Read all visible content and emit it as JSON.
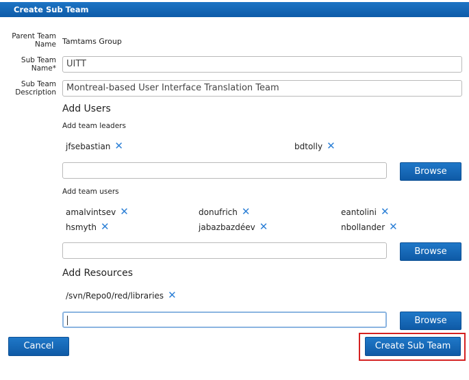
{
  "dialog": {
    "title": "Create Sub Team"
  },
  "form": {
    "parent_team_label": "Parent Team Name",
    "parent_team_value": "Tamtams Group",
    "sub_team_name_label": "Sub Team Name*",
    "sub_team_name_value": "UITT",
    "sub_team_description_label": "Sub Team Description",
    "sub_team_description_value": "Montreal-based User Interface Translation Team"
  },
  "add_users": {
    "heading": "Add Users",
    "leaders_label": "Add team leaders",
    "leaders": [
      "jfsebastian",
      "bdtolly"
    ],
    "users_label": "Add team users",
    "users": [
      "amalvintsev",
      "donufrich",
      "eantolini",
      "hsmyth",
      "jabazbazdéev",
      "nbollander"
    ]
  },
  "add_resources": {
    "heading": "Add Resources",
    "resources": [
      "/svn/Repo0/red/libraries"
    ]
  },
  "buttons": {
    "browse": "Browse",
    "cancel": "Cancel",
    "create": "Create Sub Team"
  },
  "remove_icon": "✕",
  "colors": {
    "accent": "#1566b8",
    "remove_icon": "#2b7fd6",
    "highlight": "#d42020"
  }
}
